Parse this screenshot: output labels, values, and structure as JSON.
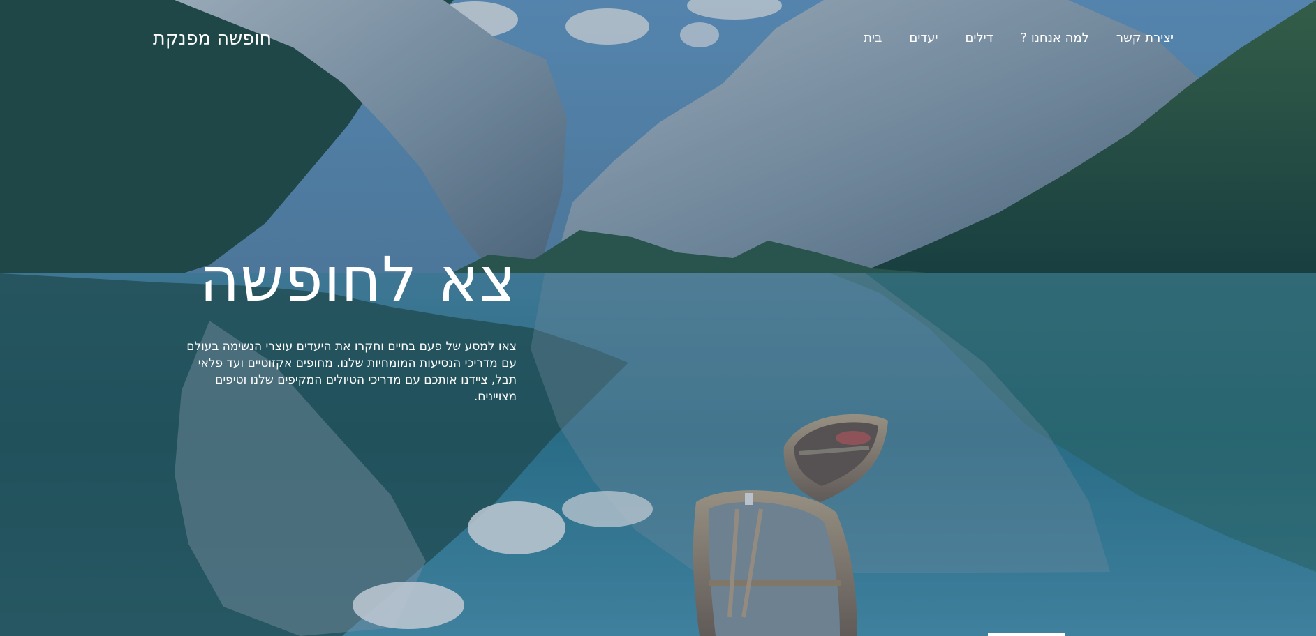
{
  "header": {
    "brand": "חופשה מפנקת",
    "nav": [
      {
        "label": "בית"
      },
      {
        "label": "יעדים"
      },
      {
        "label": "דילים"
      },
      {
        "label": "למה אנחנו ?"
      },
      {
        "label": "יצירת קשר"
      }
    ]
  },
  "hero": {
    "title": "צא לחופשה",
    "description": "צאו למסע של פעם בחיים וחקרו את היעדים עוצרי הנשימה בעולם עם מדריכי הנסיעות המומחיות שלנו. מחופים אקזוטיים ועד פלאי תבל, ציידנו אותכם עם מדריכי הטיולים המקיפים שלנו וטיפים מצויינים."
  },
  "colors": {
    "text": "#ffffff",
    "sky": "#5d91b8",
    "lake": "#2f7f95",
    "forest": "#1f4a3a",
    "overlay": "#1d3d61"
  }
}
